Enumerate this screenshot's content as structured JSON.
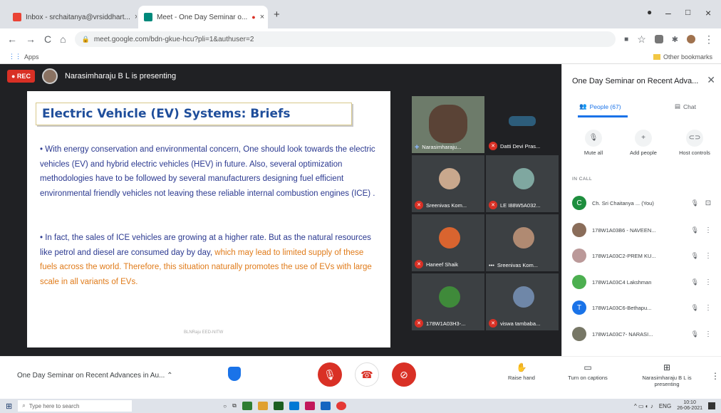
{
  "browser": {
    "tabs": [
      {
        "label": "Inbox - srchaitanya@vrsiddhart...",
        "icon": "gmail-icon",
        "close": "×"
      },
      {
        "label": "Meet - One Day Seminar o...",
        "icon": "meet-icon",
        "close": "×",
        "recording_dot": "●"
      }
    ],
    "new_tab": "+",
    "window_controls": {
      "minimize": "–",
      "maximize": "□",
      "close": "×"
    },
    "url": "meet.google.com/bdn-gkue-hcu?pli=1&authuser=2",
    "bookmarks": {
      "apps": "Apps",
      "other": "Other bookmarks"
    }
  },
  "meet": {
    "rec_label": "● REC",
    "presenter_banner": "Narasimharaju B L is presenting",
    "slide": {
      "title": "Electric Vehicle (EV) Systems: Briefs",
      "bullet1": "• With energy conservation and environmental concern, One should look towards the electric vehicles (EV) and hybrid electric vehicles (HEV) in future. Also, several optimization methodologies have to be followed by several manufacturers designing fuel efficient environmental friendly vehicles not leaving these reliable internal combustion engines (ICE) .",
      "bullet2_blue": "• In fact, the sales of ICE vehicles are growing at a higher rate. But as the natural resources like petrol and diesel are consumed day by day, ",
      "bullet2_orange": "which may lead to limited supply  of these fuels across the world. Therefore, this situation naturally promotes the use of EVs with large scale in all variants of EVs.",
      "footer": "BLNRaju EED-NITW"
    },
    "tiles": [
      {
        "name": "Narasimharaju..."
      },
      {
        "name": "Datti Devi Pras..."
      },
      {
        "name": "Sreenivas Kom..."
      },
      {
        "name": "LE I88W5A032..."
      },
      {
        "name": "Haneef Shaik"
      },
      {
        "name": "Sreenivas Kom..."
      },
      {
        "name": "178W1A03H3-..."
      },
      {
        "name": "viswa tambaba..."
      }
    ],
    "meeting_title": "One Day Seminar on Recent Advances in Au...",
    "controls": {
      "raise_hand": "Raise hand",
      "captions": "Turn on captions",
      "presenting": "Narasimharaju B L is presenting"
    }
  },
  "panel": {
    "title": "One Day Seminar on Recent Adva...",
    "people_tab": "People (67)",
    "chat_tab": "Chat",
    "actions": [
      "Mute all",
      "Add people",
      "Host controls"
    ],
    "in_call": "IN CALL",
    "people": [
      {
        "name": "Ch. Sri Chaitanya ... (You)",
        "initial": "C",
        "color": "#1e8e3e"
      },
      {
        "name": "178W1A03B6 - NAVEEN...",
        "initial": "",
        "color": "#8a6d5a"
      },
      {
        "name": "178W1A03C2-PREM KU...",
        "initial": "",
        "color": "#a88"
      },
      {
        "name": "178W1A03C4 Lakshman",
        "initial": "",
        "color": "#5c7"
      },
      {
        "name": "178W1A03C6-Bethapu...",
        "initial": "T",
        "color": "#1a73e8"
      },
      {
        "name": "178W1A03C7- NARASI...",
        "initial": "",
        "color": "#776"
      }
    ]
  },
  "taskbar": {
    "search_placeholder": "Type here to search",
    "lang": "ENG",
    "time": "10:10",
    "date": "26-06-2021"
  }
}
